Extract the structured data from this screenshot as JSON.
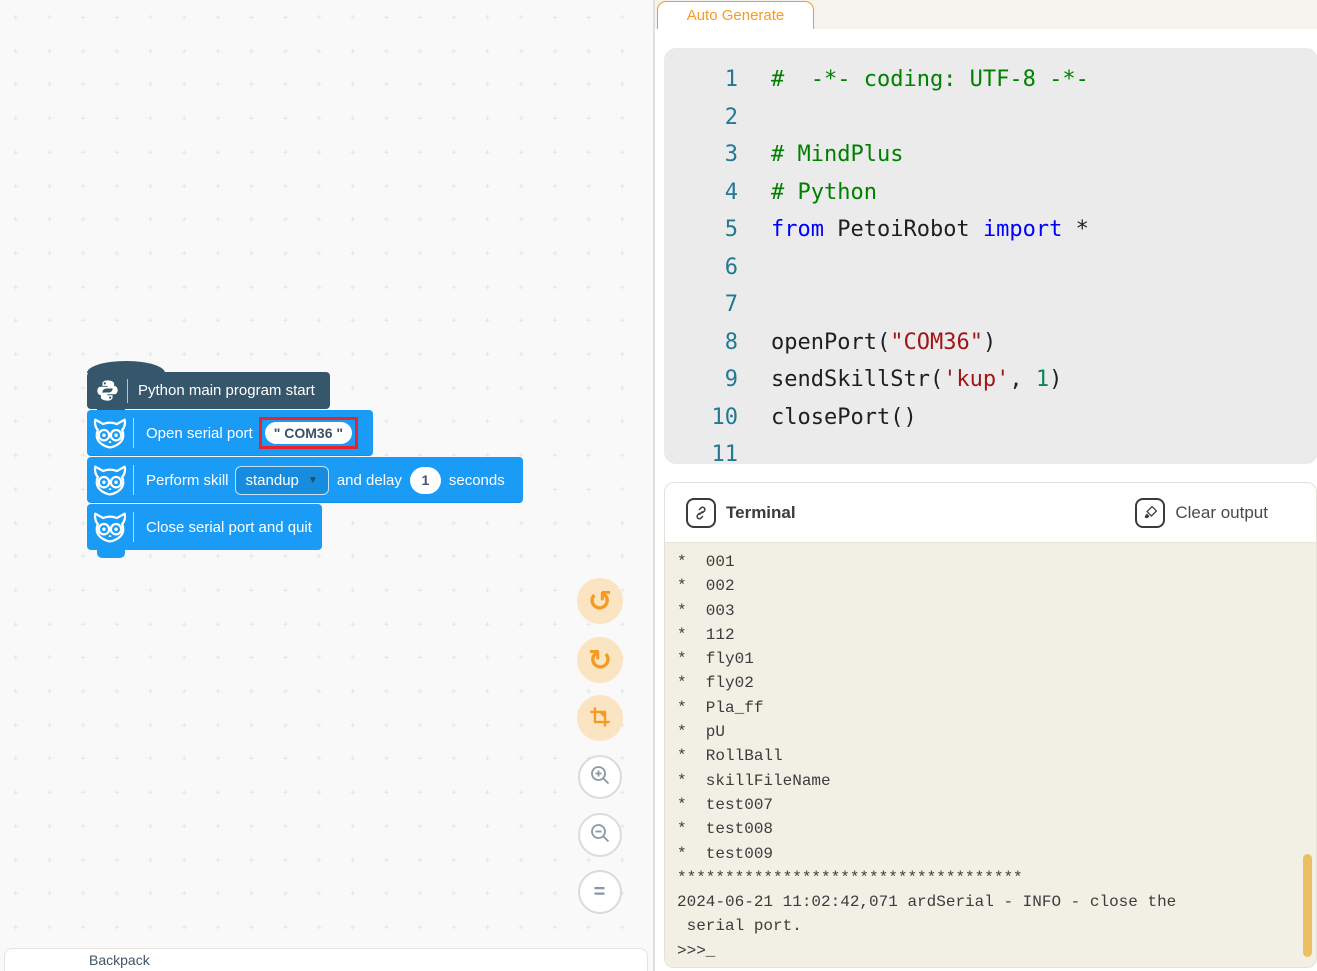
{
  "tabs": {
    "auto_generate": "Auto Generate"
  },
  "canvas": {
    "backpack_label": "Backpack"
  },
  "icons": {
    "undo": "↺",
    "redo": "↻",
    "zoom_reset": "=",
    "dropdown_caret": "▼"
  },
  "colors": {
    "block_blue": "#1A9BF5",
    "hat_block": "#35566B",
    "accent_orange": "#F59A23",
    "highlight_red": "#E8232A",
    "terminal_bg": "#F2EFE5",
    "scrollbar": "#ECBF63"
  },
  "blocks": {
    "hat": {
      "label": "Python main program start"
    },
    "open_serial": {
      "label": "Open serial port",
      "port_value": "\" COM36 \""
    },
    "perform_skill": {
      "label_prefix": "Perform skill",
      "skill_value": "standup",
      "label_middle": "and delay",
      "delay_value": "1",
      "label_suffix": "seconds"
    },
    "close_serial": {
      "label": "Close serial port and quit"
    }
  },
  "code": {
    "lines": [
      {
        "num": "1",
        "tokens": [
          {
            "t": "#  -*- coding: UTF-8 -*-",
            "c": "com"
          }
        ]
      },
      {
        "num": "2",
        "tokens": []
      },
      {
        "num": "3",
        "tokens": [
          {
            "t": "# MindPlus",
            "c": "com"
          }
        ]
      },
      {
        "num": "4",
        "tokens": [
          {
            "t": "# Python",
            "c": "com"
          }
        ]
      },
      {
        "num": "5",
        "tokens": [
          {
            "t": "from",
            "c": "kw"
          },
          {
            "t": " PetoiRobot ",
            "c": "pln"
          },
          {
            "t": "import",
            "c": "kw"
          },
          {
            "t": " *",
            "c": "pln"
          }
        ]
      },
      {
        "num": "6",
        "tokens": []
      },
      {
        "num": "7",
        "tokens": []
      },
      {
        "num": "8",
        "tokens": [
          {
            "t": "openPort(",
            "c": "pln"
          },
          {
            "t": "\"COM36\"",
            "c": "str"
          },
          {
            "t": ")",
            "c": "pln"
          }
        ]
      },
      {
        "num": "9",
        "tokens": [
          {
            "t": "sendSkillStr(",
            "c": "pln"
          },
          {
            "t": "'kup'",
            "c": "str"
          },
          {
            "t": ", ",
            "c": "pln"
          },
          {
            "t": "1",
            "c": "num"
          },
          {
            "t": ")",
            "c": "pln"
          }
        ]
      },
      {
        "num": "10",
        "tokens": [
          {
            "t": "closePort()",
            "c": "pln"
          }
        ]
      },
      {
        "num": "11",
        "tokens": []
      }
    ]
  },
  "terminal": {
    "title": "Terminal",
    "clear_label": "Clear output",
    "lines": [
      "*  001",
      "*  002",
      "*  003",
      "*  112",
      "*  fly01",
      "*  fly02",
      "*  Pla_ff",
      "*  pU",
      "*  RollBall",
      "*  skillFileName",
      "*  test007",
      "*  test008",
      "*  test009",
      "************************************",
      "2024-06-21 11:02:42,071 ardSerial - INFO - close the",
      " serial port.",
      ">>>_"
    ]
  }
}
